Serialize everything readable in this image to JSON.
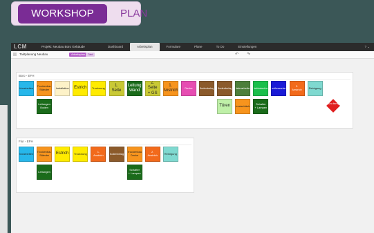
{
  "badge": {
    "word1": "WORKSHOP",
    "word2": "PLAN"
  },
  "app": {
    "logo": "LCM",
    "project": "Projekt: Neubau Büro Gebäude",
    "nav": [
      "Dashboard",
      "Arbeitsplan",
      "Formulare",
      "Pläne",
      "To Do",
      "Einstellungen"
    ],
    "active_nav": 1,
    "right": "?  ⌄"
  },
  "toolbar": {
    "breadcrumb": "Taktplanung Neubau",
    "tag1": "Arbeitsplan",
    "tag2": "Takt",
    "controls": "↶ ↷"
  },
  "panels": [
    {
      "title": "Büro - EFH",
      "cards": [
        {
          "text": "Vorarbeiten",
          "color": "#27b7ea"
        },
        {
          "text": "Trockenbau Ständer",
          "color": "#f7941d"
        },
        {
          "text": "Installation",
          "color": "#fdf2c8"
        },
        {
          "text": "Estrich",
          "color": "#ffeb00",
          "big": true
        },
        {
          "text": "Trocknung",
          "color": "#ffeb00"
        },
        {
          "text": "1. Seite",
          "color": "#c9c935",
          "big": true
        },
        {
          "text": "Leitung Wand",
          "color": "#1a6b1a",
          "light": true,
          "big": true
        },
        {
          "text": "2. Seite + GS",
          "color": "#c9c935",
          "big": true
        },
        {
          "text": "1. Anstrich",
          "color": "#f7941d",
          "big": true
        },
        {
          "text": "Decke",
          "color": "#e64db2",
          "light": true
        },
        {
          "text": "Bodenbelag",
          "color": "#8b5a2b",
          "light": true
        },
        {
          "text": "Bodenbelag",
          "color": "#8b5a2b",
          "light": true
        },
        {
          "text": "Malerarbeiten",
          "color": "#4d7f3b",
          "light": true
        },
        {
          "text": "Elektrotechnik",
          "color": "#1bbf4b",
          "light": true
        },
        {
          "text": "Abschlussarbeiten",
          "color": "#1a1ad6",
          "light": true
        },
        {
          "text": "2. Anstrich",
          "color": "#f26a1b",
          "light": true
        },
        {
          "text": "Reinigung",
          "color": "#7fd9d0"
        }
      ],
      "row2": [
        {
          "text": "Leitungen Boden",
          "color": "#1a6b1a",
          "light": true,
          "col": 1
        },
        {
          "text": "Türen",
          "color": "#bff0a8",
          "col": 11,
          "big": true
        },
        {
          "text": "Fensterbänke",
          "color": "#f7941d",
          "col": 12
        },
        {
          "text": "Schalter + Lampen",
          "color": "#1a6b1a",
          "light": true,
          "col": 13
        }
      ],
      "diamond": {
        "text": "Büro fertig",
        "col": 17
      }
    },
    {
      "title": "Flur - EFH",
      "cards": [
        {
          "text": "Vorarbeiten",
          "color": "#27b7ea"
        },
        {
          "text": "Trockenbau Ständer",
          "color": "#f7941d"
        },
        {
          "text": "Estrich",
          "color": "#ffeb00",
          "big": true
        },
        {
          "text": "Trocknung",
          "color": "#ffeb00"
        },
        {
          "text": "1. Anstrich",
          "color": "#f26a1b",
          "light": true
        },
        {
          "text": "Bodenbelag",
          "color": "#8b5a2b",
          "light": true
        },
        {
          "text": "Trockenbau Decke",
          "color": "#f7941d"
        },
        {
          "text": "2. Anstrich",
          "color": "#f26a1b",
          "light": true
        },
        {
          "text": "Reinigung",
          "color": "#7fd9d0"
        }
      ],
      "row2": [
        {
          "text": "Leitungen",
          "color": "#1a6b1a",
          "light": true,
          "col": 1
        },
        {
          "text": "Schalter + Lampen",
          "color": "#1a6b1a",
          "light": true,
          "col": 6
        }
      ]
    }
  ]
}
